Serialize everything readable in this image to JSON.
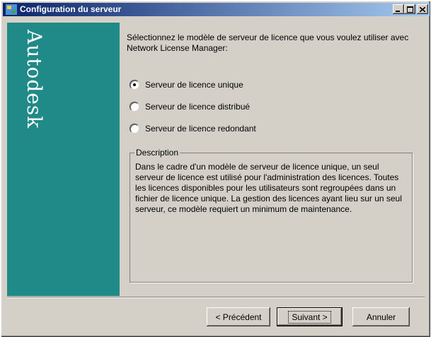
{
  "window": {
    "title": "Configuration du serveur"
  },
  "banner": {
    "logo_text": "Autodesk"
  },
  "content": {
    "intro": "Sélectionnez le modèle de serveur de licence que vous voulez utiliser avec Network License Manager:",
    "options": [
      {
        "label": "Serveur de licence unique",
        "selected": true
      },
      {
        "label": "Serveur de licence distribué",
        "selected": false
      },
      {
        "label": "Serveur de licence redondant",
        "selected": false
      }
    ],
    "description_title": "Description",
    "description_text": "Dans le cadre d'un modèle de serveur de licence unique, un seul serveur de licence est utilisé pour l'administration des licences. Toutes les licences disponibles pour les utilisateurs sont regroupées dans un fichier de licence unique. La gestion des licences ayant lieu sur un seul serveur, ce modèle requiert un minimum de maintenance."
  },
  "buttons": {
    "back": "< Précédent",
    "next": "Suivant >",
    "cancel": "Annuler"
  }
}
